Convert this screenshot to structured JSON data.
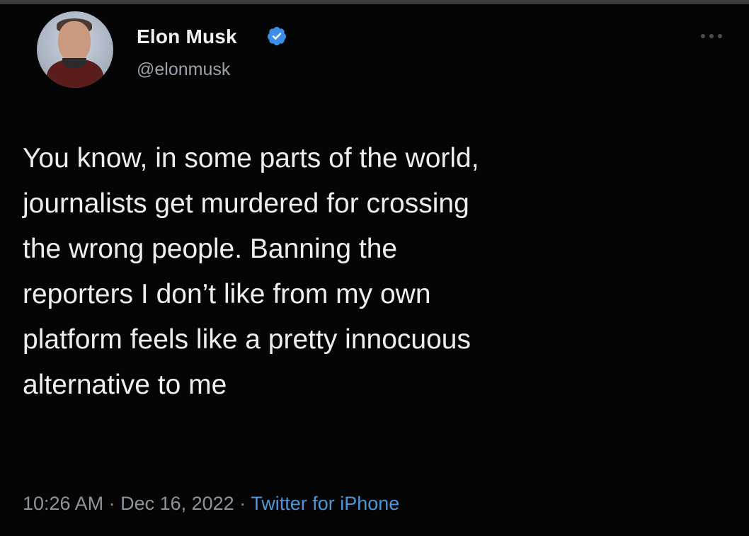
{
  "tweet": {
    "author": {
      "display_name": "Elon Musk",
      "handle": "@elonmusk",
      "verified": true,
      "avatar_icon": "profile-photo"
    },
    "text": "You know, in some parts of the world,\njournalists get murdered for crossing\nthe wrong people. Banning the\nreporters I don’t like from my own\nplatform feels like a pretty innocuous\nalternative to me",
    "time": "10:26 AM",
    "separator": " · ",
    "date": "Dec 16, 2022",
    "source": "Twitter for iPhone",
    "more_icon": "more-options-icon"
  },
  "colors": {
    "background": "#050505",
    "text": "#eceef0",
    "muted": "#8b939b",
    "link": "#4e95d6",
    "verified": "#3a8ee6"
  }
}
